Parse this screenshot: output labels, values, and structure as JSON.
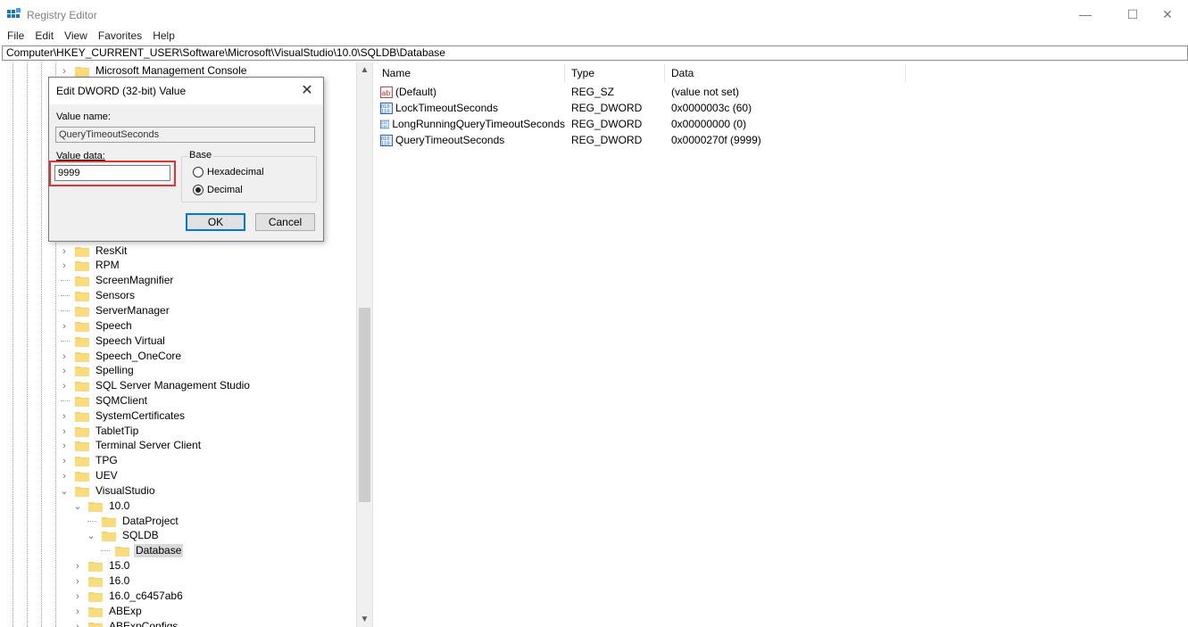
{
  "window": {
    "title": "Registry Editor",
    "minimize_glyph": "—",
    "maximize_glyph": "☐",
    "close_glyph": "✕"
  },
  "menu": [
    "File",
    "Edit",
    "View",
    "Favorites",
    "Help"
  ],
  "address": "Computer\\HKEY_CURRENT_USER\\Software\\Microsoft\\VisualStudio\\10.0\\SQLDB\\Database",
  "tree": {
    "items": [
      {
        "label": "Microsoft Management Console",
        "expander": "›"
      },
      {
        "label": "ResKit",
        "expander": "›"
      },
      {
        "label": "RPM",
        "expander": "›"
      },
      {
        "label": "ScreenMagnifier",
        "expander": ""
      },
      {
        "label": "Sensors",
        "expander": ""
      },
      {
        "label": "ServerManager",
        "expander": ""
      },
      {
        "label": "Speech",
        "expander": "›"
      },
      {
        "label": "Speech Virtual",
        "expander": ""
      },
      {
        "label": "Speech_OneCore",
        "expander": "›"
      },
      {
        "label": "Spelling",
        "expander": "›"
      },
      {
        "label": "SQL Server Management Studio",
        "expander": "›"
      },
      {
        "label": "SQMClient",
        "expander": ""
      },
      {
        "label": "SystemCertificates",
        "expander": "›"
      },
      {
        "label": "TabletTip",
        "expander": "›"
      },
      {
        "label": "Terminal Server Client",
        "expander": "›"
      },
      {
        "label": "TPG",
        "expander": "›"
      },
      {
        "label": "UEV",
        "expander": "›"
      },
      {
        "label": "VisualStudio",
        "expander": "⌄"
      },
      {
        "label": "10.0",
        "expander": "⌄"
      },
      {
        "label": "DataProject",
        "expander": ""
      },
      {
        "label": "SQLDB",
        "expander": "⌄"
      },
      {
        "label": "Database",
        "expander": ""
      },
      {
        "label": "15.0",
        "expander": "›"
      },
      {
        "label": "16.0",
        "expander": "›"
      },
      {
        "label": "16.0_c6457ab6",
        "expander": "›"
      },
      {
        "label": "ABExp",
        "expander": "›"
      },
      {
        "label": "ABExpConfigs",
        "expander": "›"
      }
    ]
  },
  "list": {
    "columns": {
      "name": "Name",
      "type": "Type",
      "data": "Data"
    },
    "rows": [
      {
        "name": "(Default)",
        "type": "REG_SZ",
        "data": "(value not set)",
        "icon": "string-value-icon"
      },
      {
        "name": "LockTimeoutSeconds",
        "type": "REG_DWORD",
        "data": "0x0000003c (60)",
        "icon": "binary-value-icon"
      },
      {
        "name": "LongRunningQueryTimeoutSeconds",
        "type": "REG_DWORD",
        "data": "0x00000000 (0)",
        "icon": "binary-value-icon"
      },
      {
        "name": "QueryTimeoutSeconds",
        "type": "REG_DWORD",
        "data": "0x0000270f (9999)",
        "icon": "binary-value-icon"
      }
    ]
  },
  "dialog": {
    "title": "Edit DWORD (32-bit) Value",
    "close_glyph": "✕",
    "value_name_label": "Value name:",
    "value_name": "QueryTimeoutSeconds",
    "value_data_label": "Value data:",
    "value_data": "9999",
    "base_label": "Base",
    "hex_label": "Hexadecimal",
    "dec_label": "Decimal",
    "selected_base": "Decimal",
    "ok_label": "OK",
    "cancel_label": "Cancel"
  },
  "colors": {
    "highlight": "#d9363a",
    "folder": "#f5d36b",
    "accent": "#0078d7"
  }
}
